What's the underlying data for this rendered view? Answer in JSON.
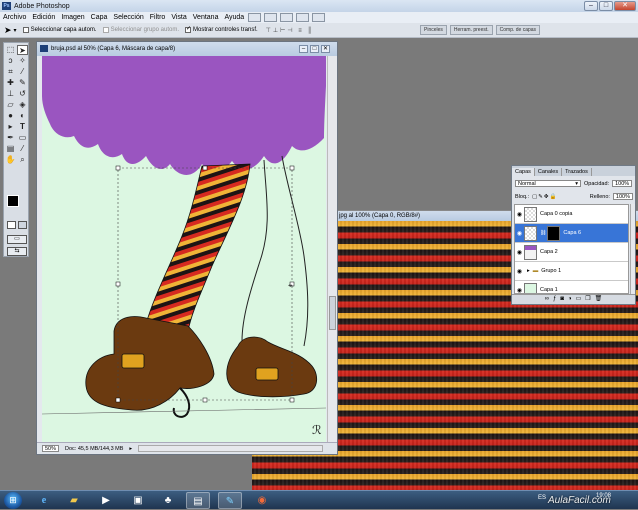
{
  "app": {
    "title": "Adobe Photoshop",
    "logo": "Ps"
  },
  "menu": [
    "Archivo",
    "Edición",
    "Imagen",
    "Capa",
    "Selección",
    "Filtro",
    "Vista",
    "Ventana",
    "Ayuda"
  ],
  "options": {
    "auto_select_layer": "Seleccionar capa autom.",
    "auto_select_group": "Seleccionar grupo autom.",
    "show_transform": "Mostrar controles transf."
  },
  "panel_well": [
    "Pinceles",
    "Herram. preest.",
    "Comp. de capas"
  ],
  "doc1": {
    "title": "bruja.psd al 50% (Capa 6, Máscara de capa/8)",
    "zoom": "50%",
    "doc_size": "Doc: 45,5 MB/144,3 MB"
  },
  "doc2": {
    "title": "jpg al 100% (Capa 0, RGB/8#)"
  },
  "layers_panel": {
    "tabs": [
      "Capas",
      "Canales",
      "Trazados"
    ],
    "blend_mode": "Normal",
    "opacity_label": "Opacidad:",
    "opacity": "100%",
    "lock_label": "Bloq.:",
    "fill_label": "Relleno:",
    "fill": "100%",
    "layers": [
      {
        "name": "Capa 0 copia",
        "selected": false
      },
      {
        "name": "Capa 6",
        "selected": true
      },
      {
        "name": "Capa 2",
        "selected": false
      },
      {
        "name": "Grupo 1",
        "selected": false
      },
      {
        "name": "Capa 1",
        "selected": false
      }
    ]
  },
  "taskbar": {
    "lang": "ES",
    "time": "19:08",
    "watermark": "AulaFacil.com"
  },
  "colors": {
    "hair": "#9a55c0",
    "canvas_bg": "#dcf7e2",
    "shoe": "#6b3a10",
    "buckle": "#e0a21f",
    "stripe_red": "#d62a20",
    "stripe_gold": "#f0b437",
    "stripe_black": "#1d1414",
    "selection": "#3875d7"
  }
}
